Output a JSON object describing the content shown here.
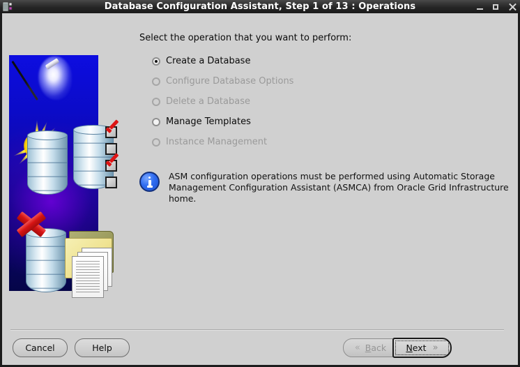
{
  "window": {
    "title": "Database Configuration Assistant, Step 1 of 13 : Operations",
    "app_icon": "database-app-icon",
    "controls": {
      "minimize": "minimize-icon",
      "maximize": "maximize-icon",
      "close": "close-icon"
    }
  },
  "colors": {
    "dialog_background": "#d0d0d0",
    "titlebar": "#262626",
    "titlebar_text": "#ffffff",
    "info_icon_blue": "#2f6cf0",
    "disabled_text": "#9a9a9a",
    "art_blue": "#0b0bc8",
    "art_purple": "#6e00dc",
    "star_yellow": "#ffd400",
    "check_red": "#dd1414"
  },
  "main": {
    "prompt": "Select the operation that you want to perform:",
    "options": [
      {
        "label": "Create a Database",
        "selected": true,
        "enabled": true
      },
      {
        "label": "Configure Database Options",
        "selected": false,
        "enabled": false
      },
      {
        "label": "Delete a Database",
        "selected": false,
        "enabled": false
      },
      {
        "label": "Manage Templates",
        "selected": false,
        "enabled": true
      },
      {
        "label": "Instance Management",
        "selected": false,
        "enabled": false
      }
    ],
    "note": {
      "icon": "info-icon",
      "text": "ASM configuration operations must be performed using Automatic Storage Management Configuration Assistant (ASMCA) from Oracle Grid Infrastructure home."
    }
  },
  "artwork": {
    "name": "dbca-wizard-illustration",
    "elements": [
      "magic-wand",
      "starburst",
      "database-cylinder",
      "checkbox-list",
      "red-x",
      "folder",
      "documents"
    ]
  },
  "footer": {
    "cancel_label": "Cancel",
    "help_label": "Help",
    "back_label": "Back",
    "back_mnemonic": "B",
    "back_enabled": false,
    "back_chevron": "«",
    "next_label": "Next",
    "next_mnemonic": "N",
    "next_enabled": true,
    "next_chevron": "»"
  }
}
